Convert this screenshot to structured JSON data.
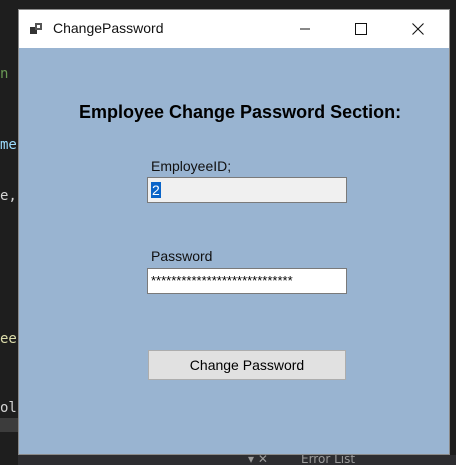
{
  "window": {
    "title": "ChangePassword",
    "controls": {
      "minimize_icon": "minimize-icon",
      "maximize_icon": "maximize-icon",
      "close_icon": "close-icon"
    }
  },
  "form": {
    "heading": "Employee Change Password Section:",
    "employee_id_label": "EmployeeID;",
    "employee_id_value": "2",
    "password_label": "Password",
    "password_value": "****************************",
    "submit_label": "Change Password"
  },
  "background": {
    "code_fragments": [
      "n",
      "me",
      "e,",
      "ee",
      "ol"
    ],
    "status_text": "Error List"
  },
  "colors": {
    "client_background": "#99b4d1",
    "selection": "#0a64c8",
    "button": "#e1e1e1"
  }
}
